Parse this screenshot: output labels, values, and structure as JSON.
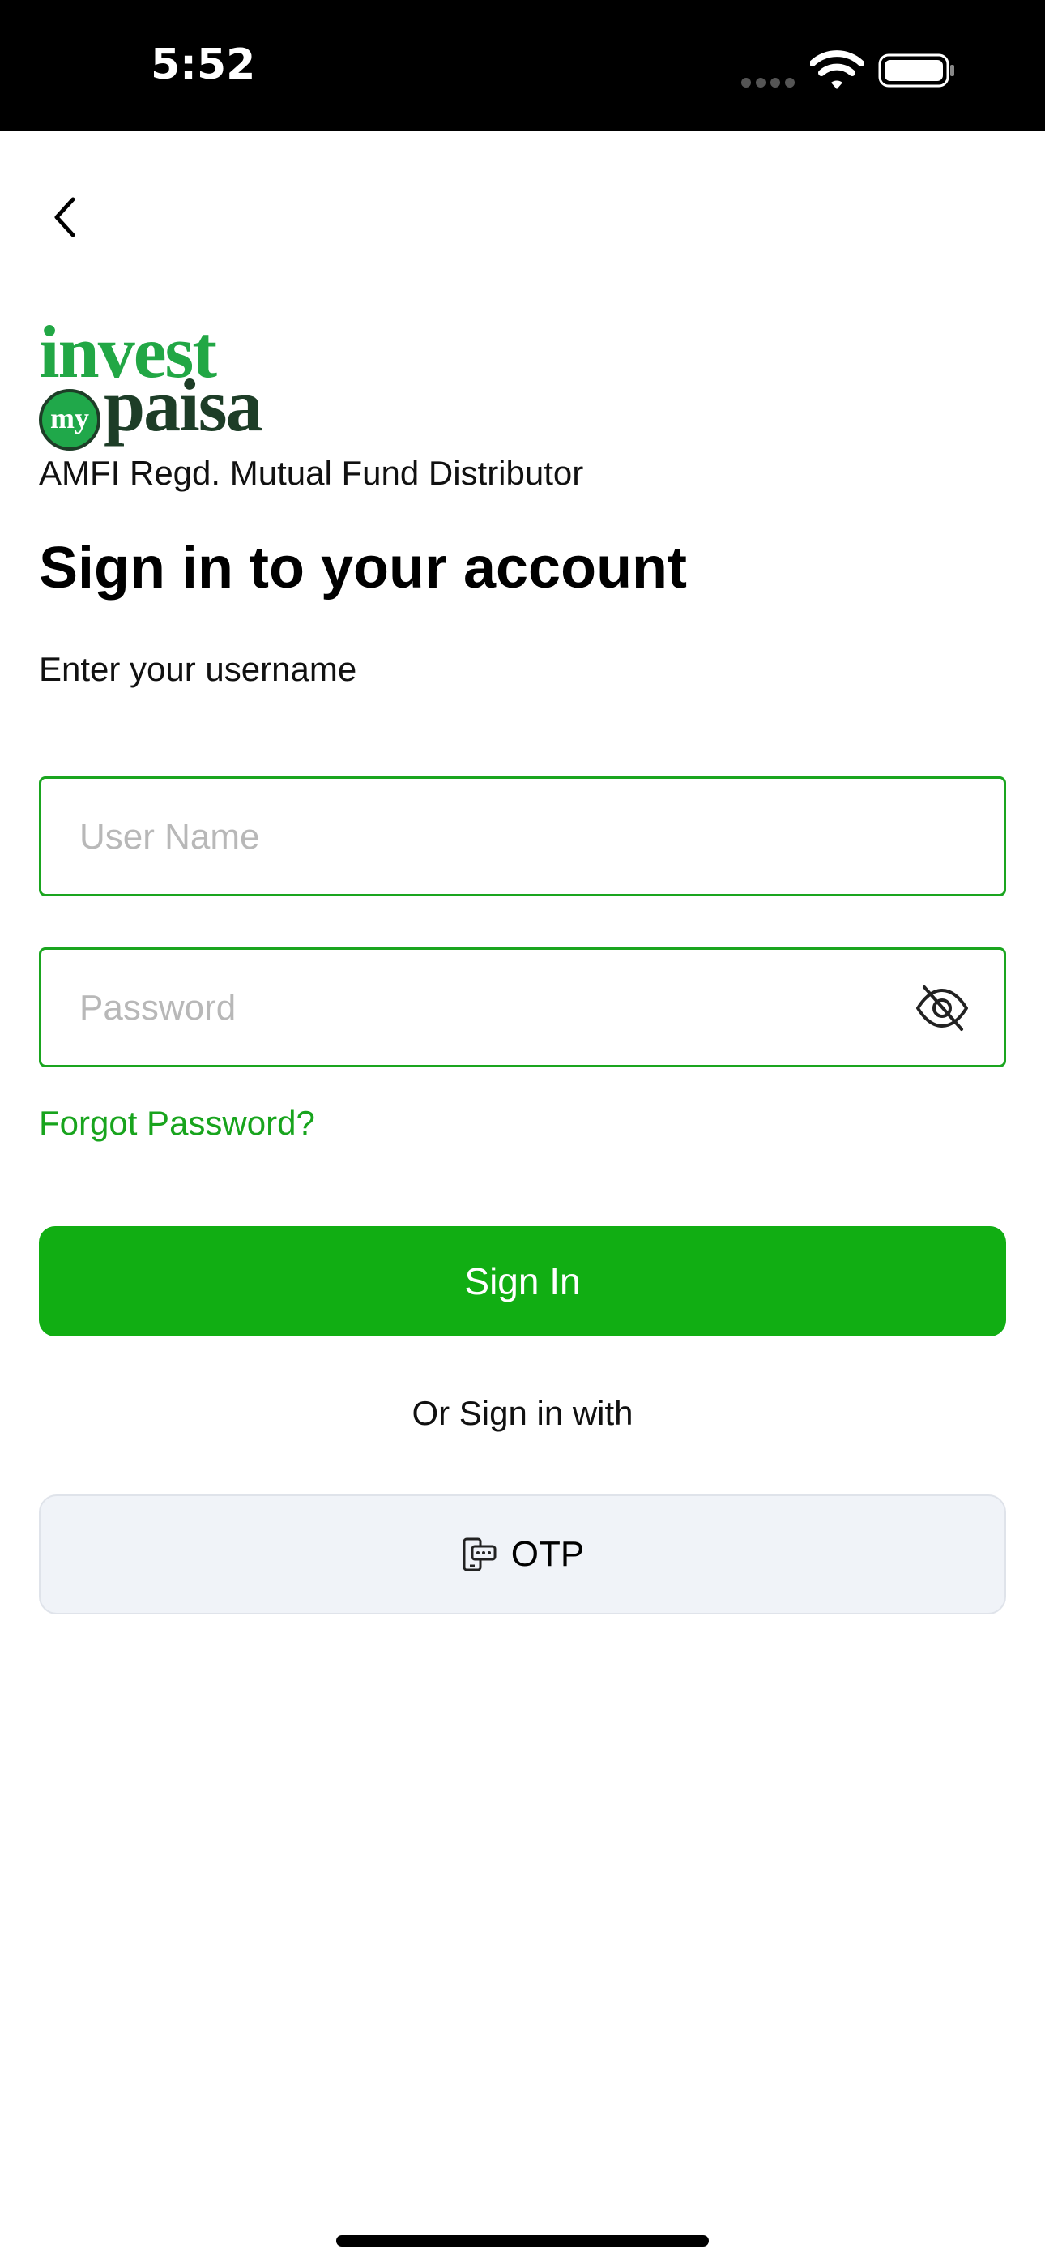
{
  "status_bar": {
    "time": "5:52",
    "icons": [
      "cellular-dots-icon",
      "wifi-icon",
      "battery-icon"
    ]
  },
  "nav": {
    "back_icon": "chevron-left-icon"
  },
  "brand": {
    "logo_line1": "invest",
    "logo_coin": "my",
    "logo_line2": "paisa",
    "tagline": "AMFI Regd. Mutual Fund Distributor",
    "colors": {
      "green": "#22a745",
      "dark_green": "#1d3d27"
    }
  },
  "form": {
    "title": "Sign in to your account",
    "subtitle": "Enter your username",
    "username": {
      "placeholder": "User Name",
      "value": ""
    },
    "password": {
      "placeholder": "Password",
      "value": "",
      "toggle_icon": "eye-slash-icon"
    },
    "forgot_label": "Forgot Password?",
    "signin_label": "Sign In",
    "or_text": "Or Sign in with",
    "otp_label": "OTP",
    "otp_icon": "phone-otp-icon"
  },
  "theme": {
    "primary": "#11ae13",
    "border": "#1aa51f",
    "link": "#18a41d",
    "otp_bg": "#f0f3f8"
  }
}
